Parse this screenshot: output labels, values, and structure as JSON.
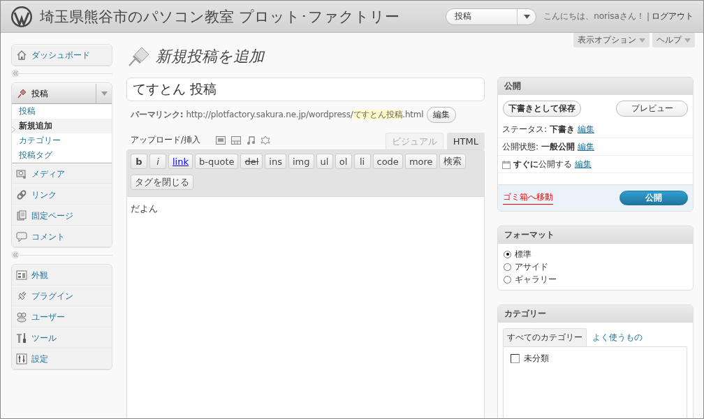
{
  "header": {
    "site_title": "埼玉県熊谷市のパソコン教室 プロット･ファクトリー",
    "quick_menu": "投稿",
    "greeting": "こんにちは、norisaさん！",
    "separator": "|",
    "logout": "ログアウト"
  },
  "screen_options": [
    "表示オプション",
    "ヘルプ"
  ],
  "sidebar": {
    "groups": [
      {
        "items": [
          {
            "label": "ダッシュボード",
            "expanded": false
          }
        ]
      },
      {
        "items": [
          {
            "label": "投稿",
            "expanded": true,
            "submenu": [
              {
                "label": "投稿",
                "selected": false
              },
              {
                "label": "新規追加",
                "selected": true
              },
              {
                "label": "カテゴリー",
                "selected": false
              },
              {
                "label": "投稿タグ",
                "selected": false
              }
            ]
          },
          {
            "label": "メディア",
            "expanded": false
          },
          {
            "label": "リンク",
            "expanded": false
          },
          {
            "label": "固定ページ",
            "expanded": false
          },
          {
            "label": "コメント",
            "expanded": false
          }
        ]
      },
      {
        "items": [
          {
            "label": "外観",
            "expanded": false
          },
          {
            "label": "プラグイン",
            "expanded": false
          },
          {
            "label": "ユーザー",
            "expanded": false
          },
          {
            "label": "ツール",
            "expanded": false
          },
          {
            "label": "設定",
            "expanded": false
          }
        ]
      }
    ]
  },
  "main": {
    "page_title": "新規投稿を追加",
    "title_field": "てすとん 投稿",
    "permalink": {
      "label": "パーマリンク:",
      "url": "http://plotfactory.sakura.ne.jp/wordpress/",
      "slug": "てすとん投稿",
      "suffix": ".html",
      "button": "編集"
    },
    "upload_label": "アップロード/挿入",
    "editor_tabs": [
      {
        "label": "ビジュアル",
        "selected": false
      },
      {
        "label": "HTML",
        "selected": true
      }
    ],
    "quicktags": [
      "b",
      "i",
      "link",
      "b-quote",
      "del",
      "ins",
      "img",
      "ul",
      "ol",
      "li",
      "code",
      "more",
      "検索",
      "タグを閉じる"
    ],
    "content": "だよん"
  },
  "publish_box": {
    "title": "公開",
    "save_draft": "下書きとして保存",
    "preview": "プレビュー",
    "rows": [
      {
        "kind": "field",
        "label": "ステータス:",
        "value": "下書き",
        "link": "編集"
      },
      {
        "kind": "field",
        "label": "公開状態:",
        "value": "一般公開",
        "link": "編集"
      },
      {
        "kind": "schedule",
        "value": "**すぐに**公開する",
        "link": "編集"
      }
    ],
    "trash": "ゴミ箱へ移動",
    "publish": "公開"
  },
  "format_box": {
    "title": "フォーマット",
    "options": [
      {
        "label": "標準",
        "selected": true
      },
      {
        "label": "アサイド",
        "selected": false
      },
      {
        "label": "ギャラリー",
        "selected": false
      }
    ]
  },
  "category_box": {
    "title": "カテゴリー",
    "tabs": [
      {
        "label": "すべてのカテゴリー",
        "selected": true
      },
      {
        "label": "よく使うもの",
        "selected": false
      }
    ],
    "items": [
      {
        "label": "未分類",
        "checked": false
      }
    ]
  }
}
